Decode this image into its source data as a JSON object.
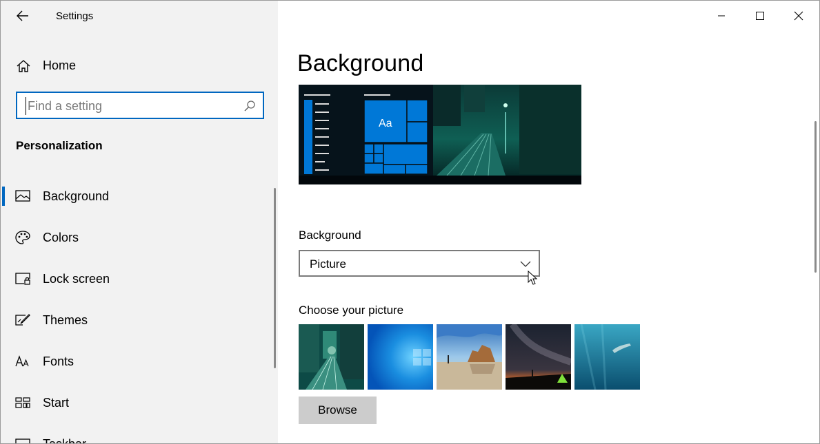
{
  "window": {
    "app_title": "Settings",
    "controls": {
      "minimize": "minimize",
      "maximize": "maximize",
      "close": "close"
    }
  },
  "sidebar": {
    "home_label": "Home",
    "search_placeholder": "Find a setting",
    "section_title": "Personalization",
    "active_item": "Background",
    "items": [
      {
        "label": "Background",
        "icon": "picture-icon"
      },
      {
        "label": "Colors",
        "icon": "palette-icon"
      },
      {
        "label": "Lock screen",
        "icon": "lock-screen-icon"
      },
      {
        "label": "Themes",
        "icon": "themes-brush-icon"
      },
      {
        "label": "Fonts",
        "icon": "fonts-icon"
      },
      {
        "label": "Start",
        "icon": "start-icon"
      },
      {
        "label": "Taskbar",
        "icon": "taskbar-icon"
      }
    ]
  },
  "main": {
    "page_title": "Background",
    "preview_tile_text": "Aa",
    "background_label": "Background",
    "background_dropdown_value": "Picture",
    "choose_picture_label": "Choose your picture",
    "browse_label": "Browse",
    "pictures": [
      "city-night-picture",
      "windows-blue-picture",
      "beach-rocks-picture",
      "night-sky-tent-picture",
      "underwater-swimmer-picture"
    ]
  },
  "colors": {
    "accent": "#0067c0",
    "tile_blue": "#0078d7",
    "sidebar_bg": "#f2f2f2",
    "button_bg": "#cccccc"
  }
}
